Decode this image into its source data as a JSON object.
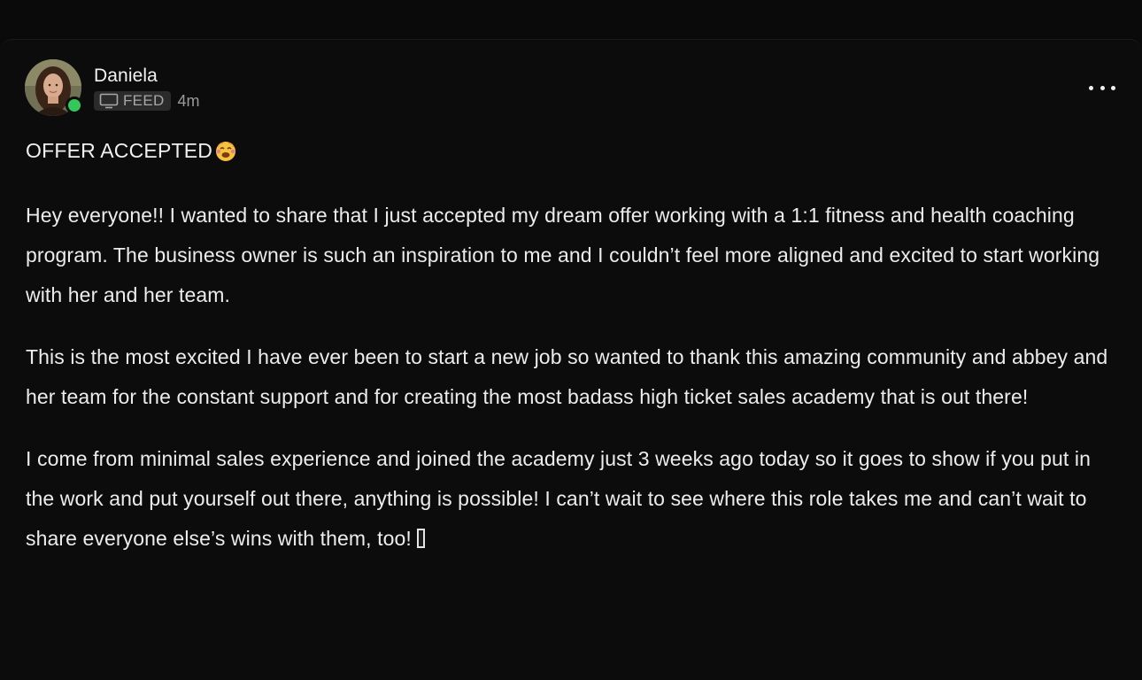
{
  "post": {
    "author": "Daniela",
    "channel_icon": "monitor-icon",
    "channel": "FEED",
    "time_ago": "4m",
    "online_status_color": "#34c759",
    "menu_icon": "more-horizontal-icon",
    "title": "OFFER ACCEPTED",
    "title_emoji": "face-with-tears-emoji",
    "paragraphs": [
      "Hey everyone!! I wanted to share that I just accepted my dream offer working with a 1:1 fitness and health coaching program. The business owner is such an inspiration to me and I couldn’t feel more aligned and excited to start working with her and her team.",
      "This is the most excited I have ever been to start a new job so wanted to thank this amazing community and abbey and her team for the constant support and for creating the most badass high ticket sales academy that is out there!",
      "I come from minimal sales experience and joined the academy just 3 weeks ago today so it goes to show if you put in the work and put yourself out there, anything is possible! I can’t wait to see where this role takes me and can’t wait to share everyone else’s wins with them, too!"
    ]
  }
}
